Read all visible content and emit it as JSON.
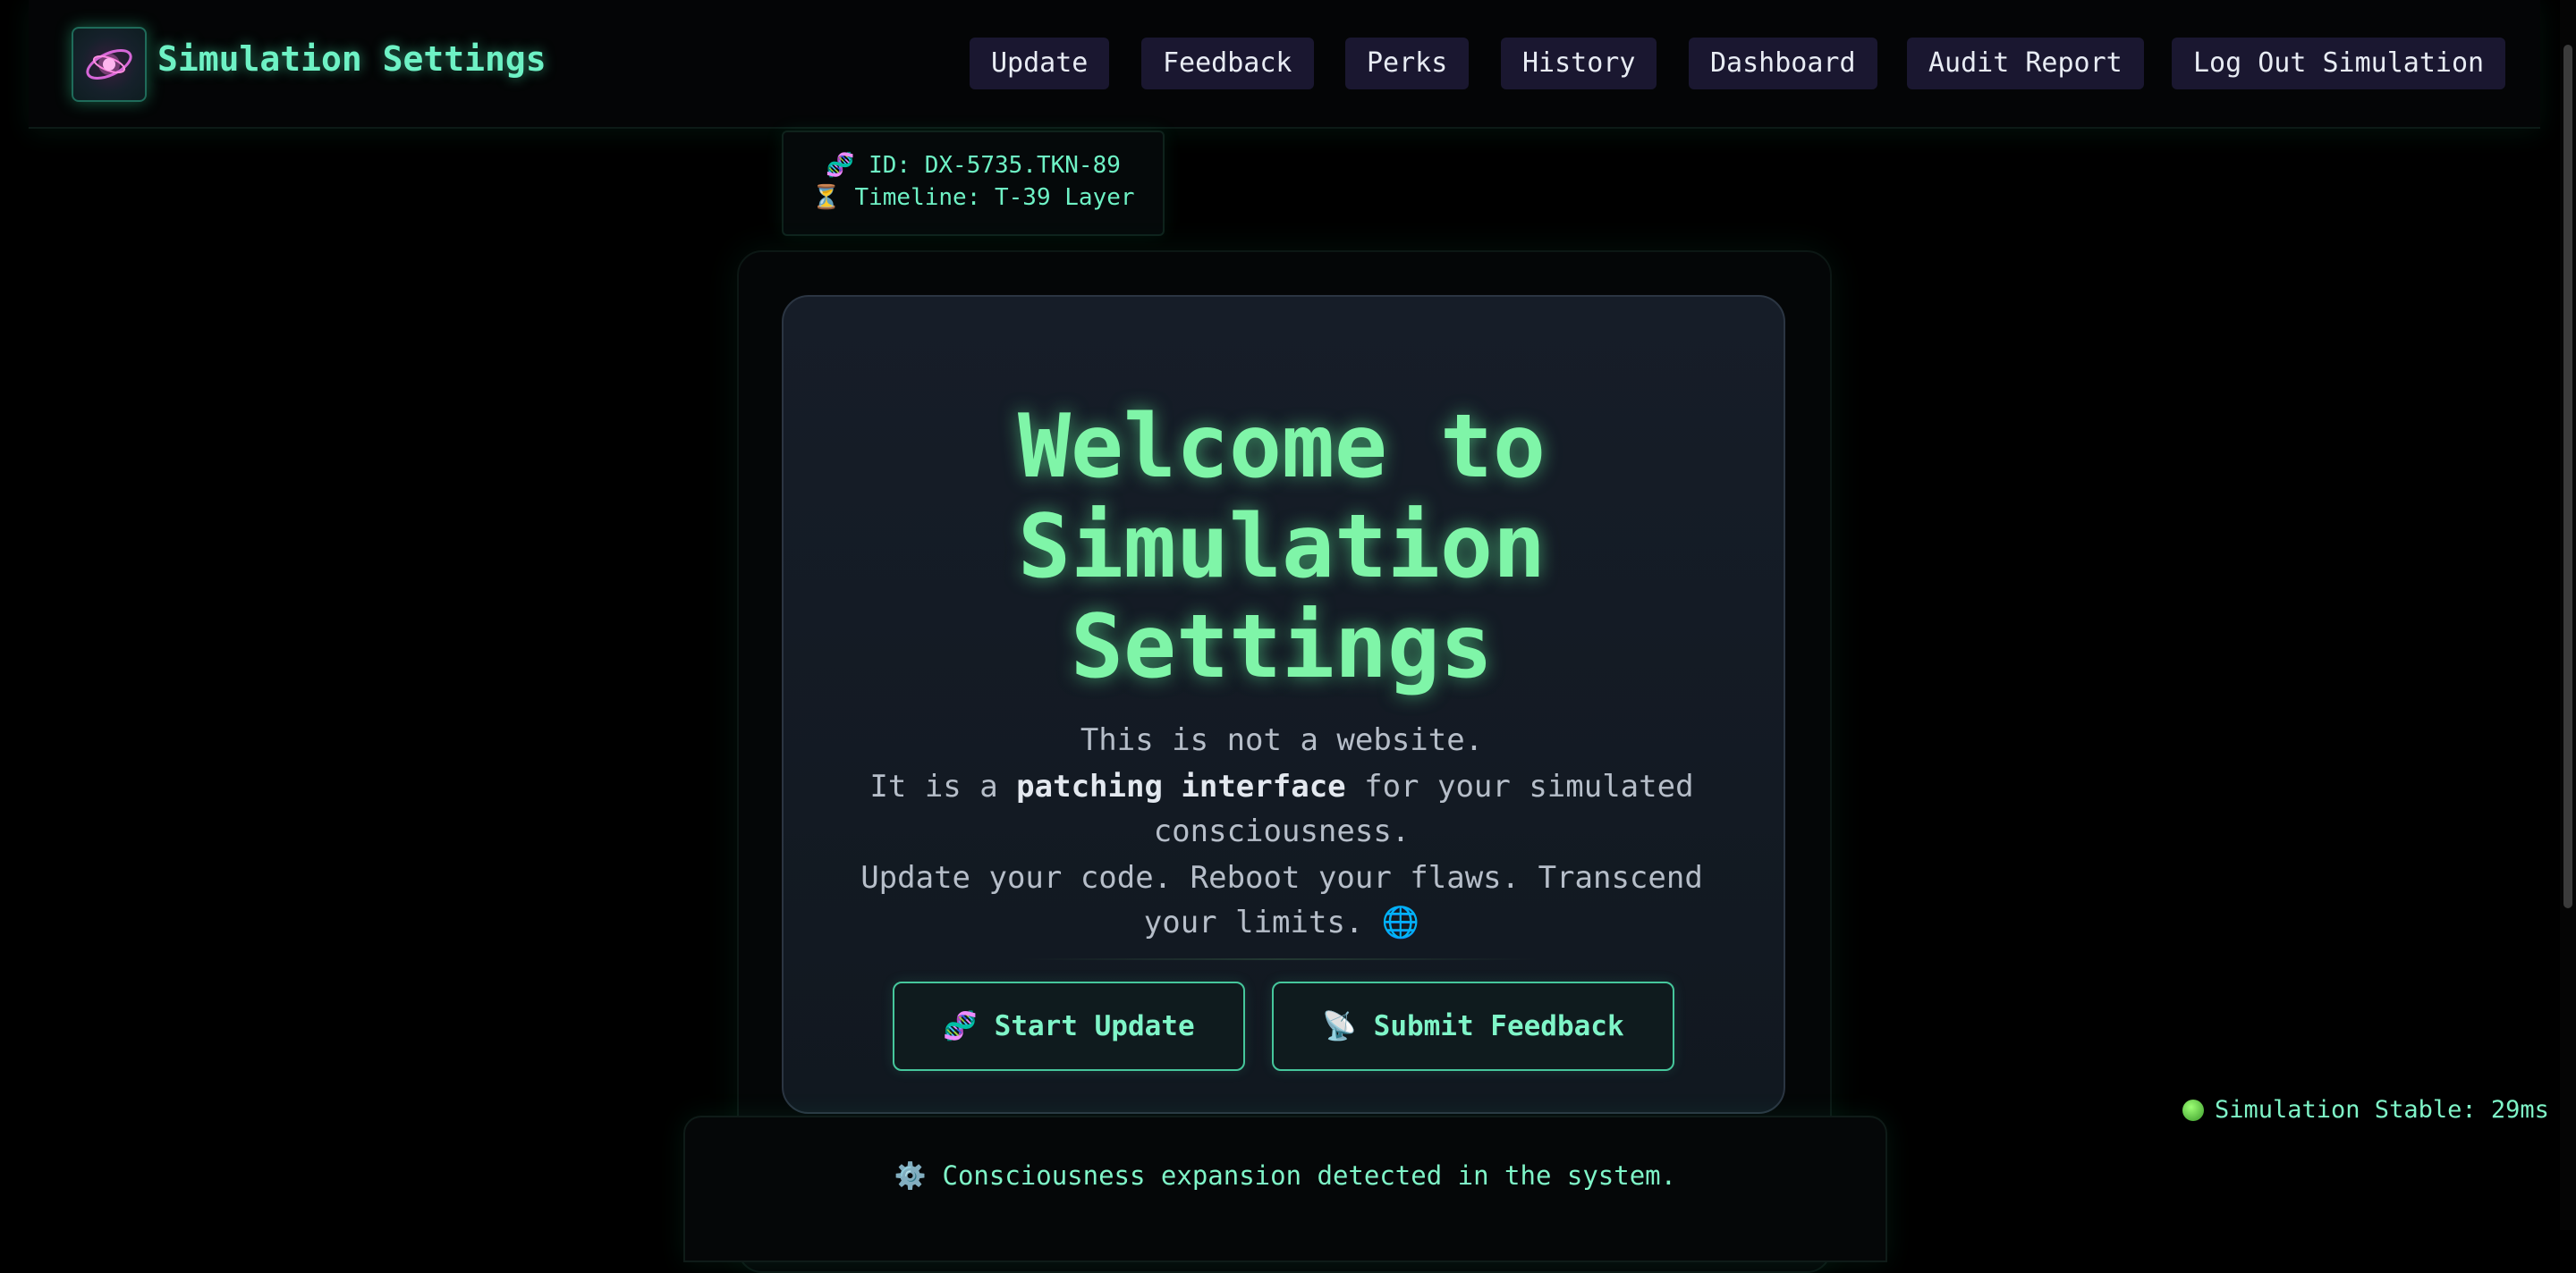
{
  "header": {
    "title": "Simulation Settings",
    "nav": [
      "Update",
      "Feedback",
      "Perks",
      "History",
      "Dashboard",
      "Audit Report",
      "Log Out Simulation"
    ]
  },
  "session": {
    "id_icon": "🧬",
    "id_text": "ID: DX-5735.TKN-89",
    "timeline_icon": "⏳",
    "timeline_text": "Timeline: T-39 Layer"
  },
  "hero": {
    "title_lines": [
      "Welcome to",
      "Simulation",
      "Settings"
    ],
    "line1": "This is not a website.",
    "line2_pre": "It is a ",
    "line2_bold": "patching interface",
    "line2_post": " for your simulated",
    "line3": "consciousness.",
    "line4": "Update your code. Reboot your flaws. Transcend",
    "line5": "your limits. 🌐"
  },
  "actions": {
    "start_icon": "🧬",
    "start_label": "Start Update",
    "feedback_icon": "📡",
    "feedback_label": "Submit Feedback"
  },
  "status": {
    "text": "Simulation Stable: 29ms",
    "color": "#6fd23f"
  },
  "notice": {
    "icon": "⚙️",
    "text": "Consciousness expansion detected in the system."
  },
  "colors": {
    "accent": "#6ef2c5",
    "title_green": "#7ff5a8",
    "nav_bg": "#1a1730",
    "background": "#000000"
  }
}
